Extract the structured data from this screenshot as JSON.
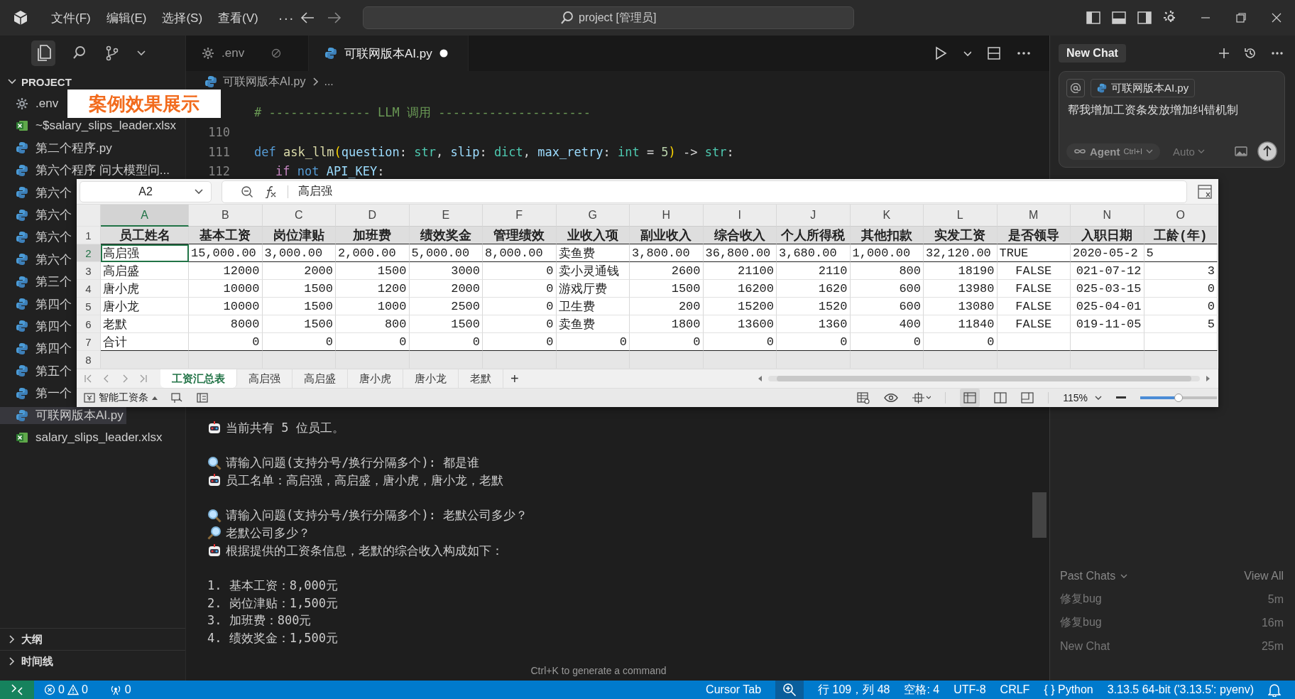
{
  "title_bar": {
    "menus": [
      "文件(F)",
      "编辑(E)",
      "选择(S)",
      "查看(V)"
    ],
    "more": "···",
    "search": "project [管理员]"
  },
  "sidebar": {
    "header": "PROJECT",
    "expanded": true,
    "items": [
      {
        "label": ".env",
        "kind": "config",
        "selected": false
      },
      {
        "label": "~$salary_slips_leader.xlsx",
        "kind": "excel",
        "selected": false
      },
      {
        "label": "第二个程序.py",
        "kind": "python",
        "selected": false
      },
      {
        "label": "第六个程序 问大模型问...",
        "kind": "python",
        "selected": false
      },
      {
        "label": "第六个",
        "kind": "python",
        "selected": false
      },
      {
        "label": "第六个",
        "kind": "python",
        "selected": false
      },
      {
        "label": "第六个",
        "kind": "python",
        "selected": false
      },
      {
        "label": "第六个",
        "kind": "python",
        "selected": false
      },
      {
        "label": "第三个",
        "kind": "python",
        "selected": false
      },
      {
        "label": "第四个",
        "kind": "python",
        "selected": false
      },
      {
        "label": "第四个",
        "kind": "python",
        "selected": false
      },
      {
        "label": "第四个",
        "kind": "python",
        "selected": false
      },
      {
        "label": "第五个",
        "kind": "python",
        "selected": false
      },
      {
        "label": "第一个",
        "kind": "python",
        "selected": false
      },
      {
        "label": "可联网版本AI.py",
        "kind": "python",
        "selected": true
      },
      {
        "label": "salary_slips_leader.xlsx",
        "kind": "excel",
        "selected": false
      }
    ],
    "sections": [
      {
        "label": "大纲",
        "expanded": false
      },
      {
        "label": "时间线",
        "expanded": false
      }
    ]
  },
  "overlay_label": "案例效果展示",
  "editor": {
    "tabs": [
      {
        "label": ".env",
        "kind": "config",
        "selected": false,
        "modified": false
      },
      {
        "label": "可联网版本AI.py",
        "kind": "python",
        "selected": true,
        "modified": true
      }
    ],
    "breadcrumb": [
      "可联网版本AI.py",
      "..."
    ],
    "code_lines": [
      {
        "tokens": [
          {
            "text": "# -------------- LLM 调用 ---------------------",
            "kind": "comment"
          }
        ]
      },
      {
        "number": "110"
      },
      {
        "number": "111",
        "tokens": [
          {
            "text": "def ",
            "kind": "keyword"
          },
          {
            "text": "ask_llm",
            "kind": "function"
          },
          {
            "text": "(",
            "kind": "paren"
          },
          {
            "text": "question",
            "kind": "param"
          },
          {
            "text": ": ",
            "kind": "plain"
          },
          {
            "text": "str",
            "kind": "type"
          },
          {
            "text": ", ",
            "kind": "plain"
          },
          {
            "text": "slip",
            "kind": "param"
          },
          {
            "text": ": ",
            "kind": "plain"
          },
          {
            "text": "dict",
            "kind": "type"
          },
          {
            "text": ", ",
            "kind": "plain"
          },
          {
            "text": "max_retry",
            "kind": "param"
          },
          {
            "text": ": ",
            "kind": "plain"
          },
          {
            "text": "int",
            "kind": "type"
          },
          {
            "text": " = ",
            "kind": "plain"
          },
          {
            "text": "5",
            "kind": "number"
          },
          {
            "text": ")",
            "kind": "paren"
          },
          {
            "text": " -> ",
            "kind": "plain"
          },
          {
            "text": "str",
            "kind": "type"
          },
          {
            "text": ":",
            "kind": "plain"
          }
        ],
        "children": [
          {
            "number": "112",
            "tokens": [
              {
                "text": "if ",
                "kind": "control"
              },
              {
                "text": "not ",
                "kind": "keyword"
              },
              {
                "text": "API_KEY",
                "kind": "param"
              },
              {
                "text": ":",
                "kind": "plain"
              }
            ]
          }
        ]
      }
    ],
    "terminal": {
      "blocks": [
        [
          {
            "kind": "robot",
            "text": "当前共有 5 位员工。"
          }
        ],
        [
          {
            "kind": "search",
            "text": "请输入问题(支持分号/换行分隔多个): 都是谁"
          },
          {
            "kind": "robot",
            "text": "员工名单：高启强，高启盛，唐小虎，唐小龙，老默"
          }
        ],
        [
          {
            "kind": "search",
            "text": "请输入问题(支持分号/换行分隔多个): 老默公司多少？"
          },
          {
            "kind": "lookup",
            "text": "老默公司多少？"
          },
          {
            "kind": "robot",
            "text": "根据提供的工资条信息，老默的综合收入构成如下："
          }
        ],
        [
          {
            "kind": "plain",
            "text": "1. 基本工资：8,000元"
          },
          {
            "kind": "plain",
            "text": "2. 岗位津贴：1,500元"
          },
          {
            "kind": "plain",
            "text": "3. 加班费：800元"
          },
          {
            "kind": "plain",
            "text": "4. 绩效奖金：1,500元"
          }
        ]
      ],
      "hint": "Ctrl+K to generate a command"
    }
  },
  "spreadsheet": {
    "name_box": "A2",
    "formula": "高启强",
    "columns": [
      {
        "letter": "A",
        "kind": "text",
        "selected": true
      },
      {
        "letter": "B",
        "kind": "number",
        "selected": false
      },
      {
        "letter": "C",
        "kind": "number",
        "selected": false
      },
      {
        "letter": "D",
        "kind": "number",
        "selected": false
      },
      {
        "letter": "E",
        "kind": "number",
        "selected": false
      },
      {
        "letter": "F",
        "kind": "number",
        "selected": false
      },
      {
        "letter": "G",
        "kind": "text",
        "selected": false
      },
      {
        "letter": "H",
        "kind": "number",
        "selected": false
      },
      {
        "letter": "I",
        "kind": "number",
        "selected": false
      },
      {
        "letter": "J",
        "kind": "number",
        "selected": false
      },
      {
        "letter": "K",
        "kind": "number",
        "selected": false
      },
      {
        "letter": "L",
        "kind": "number",
        "selected": false
      },
      {
        "letter": "M",
        "kind": "bool",
        "selected": false
      },
      {
        "letter": "N",
        "kind": "date",
        "selected": false
      },
      {
        "letter": "O",
        "kind": "number",
        "selected": false
      }
    ],
    "rows": [
      {
        "number": "1",
        "kind": "header",
        "selected": false,
        "cells": [
          "员工姓名",
          "基本工资",
          "岗位津贴",
          "加班费",
          "绩效奖金",
          "管理绩效",
          "业收入项",
          "副业收入",
          "综合收入",
          "个人所得税",
          "其他扣款",
          "实发工资",
          "是否领导",
          "入职日期",
          "工龄(年)"
        ]
      },
      {
        "number": "2",
        "kind": "formatted",
        "selected": true,
        "cells": [
          "高启强",
          "15,000.00",
          "3,000.00",
          "2,000.00",
          "5,000.00",
          "8,000.00",
          "卖鱼费",
          "3,800.00",
          "36,800.00",
          "3,680.00",
          "1,000.00",
          "32,120.00",
          "TRUE",
          "2020-05-2",
          "5"
        ]
      },
      {
        "number": "3",
        "kind": "plain",
        "selected": false,
        "cells": [
          "高启盛",
          "12000",
          "2000",
          "1500",
          "3000",
          "0",
          "卖小灵通钱",
          "2600",
          "21100",
          "2110",
          "800",
          "18190",
          "FALSE",
          "021-07-12",
          "3"
        ]
      },
      {
        "number": "4",
        "kind": "plain",
        "selected": false,
        "cells": [
          "唐小虎",
          "10000",
          "1500",
          "1200",
          "2000",
          "0",
          "游戏厅费",
          "1500",
          "16200",
          "1620",
          "600",
          "13980",
          "FALSE",
          "025-03-15",
          "0"
        ]
      },
      {
        "number": "5",
        "kind": "plain",
        "selected": false,
        "cells": [
          "唐小龙",
          "10000",
          "1500",
          "1000",
          "2500",
          "0",
          "卫生费",
          "200",
          "15200",
          "1520",
          "600",
          "13080",
          "FALSE",
          "025-04-01",
          "0"
        ]
      },
      {
        "number": "6",
        "kind": "plain",
        "selected": false,
        "cells": [
          "老默",
          "8000",
          "1500",
          "800",
          "1500",
          "0",
          "卖鱼费",
          "1800",
          "13600",
          "1360",
          "400",
          "11840",
          "FALSE",
          "019-11-05",
          "5"
        ]
      },
      {
        "number": "7",
        "kind": "total",
        "selected": false,
        "cells": [
          "合计",
          "0",
          "0",
          "0",
          "0",
          "0",
          "0",
          "0",
          "0",
          "0",
          "0",
          "0"
        ]
      },
      {
        "number": "8",
        "kind": "blank",
        "selected": false
      }
    ],
    "sheets": [
      {
        "label": "工资汇总表",
        "selected": true
      },
      {
        "label": "高启强",
        "selected": false
      },
      {
        "label": "高启盛",
        "selected": false
      },
      {
        "label": "唐小虎",
        "selected": false
      },
      {
        "label": "唐小龙",
        "selected": false
      },
      {
        "label": "老默",
        "selected": false
      }
    ],
    "add_sheet": "+",
    "status": {
      "label": "智能工资条",
      "zoom": "115%",
      "level": 0.5
    }
  },
  "chat": {
    "tab": "New Chat",
    "context_file": "可联网版本AI.py",
    "input": "帮我增加工资条发放增加纠错机制",
    "mode": "Agent",
    "shortcut": "Ctrl+I",
    "model": "Auto",
    "past_chats": "Past Chats",
    "view_all": "View All",
    "history": [
      {
        "title": "修复bug",
        "age": "5m"
      },
      {
        "title": "修复bug",
        "age": "16m"
      },
      {
        "title": "New Chat",
        "age": "25m"
      }
    ]
  },
  "status_bar": {
    "errors": "0",
    "warnings": "0",
    "ports": "0",
    "items": [
      {
        "kind": "text",
        "label": "Cursor Tab"
      },
      {
        "kind": "zoom"
      },
      {
        "kind": "text",
        "label": "行 109，列 48"
      },
      {
        "kind": "text",
        "label": "空格: 4"
      },
      {
        "kind": "text",
        "label": "UTF-8"
      },
      {
        "kind": "text",
        "label": "CRLF"
      },
      {
        "kind": "text",
        "label": "{ } Python"
      },
      {
        "kind": "text",
        "label": "3.13.5 64-bit ('3.13.5': pyenv)"
      },
      {
        "kind": "bell"
      }
    ]
  }
}
